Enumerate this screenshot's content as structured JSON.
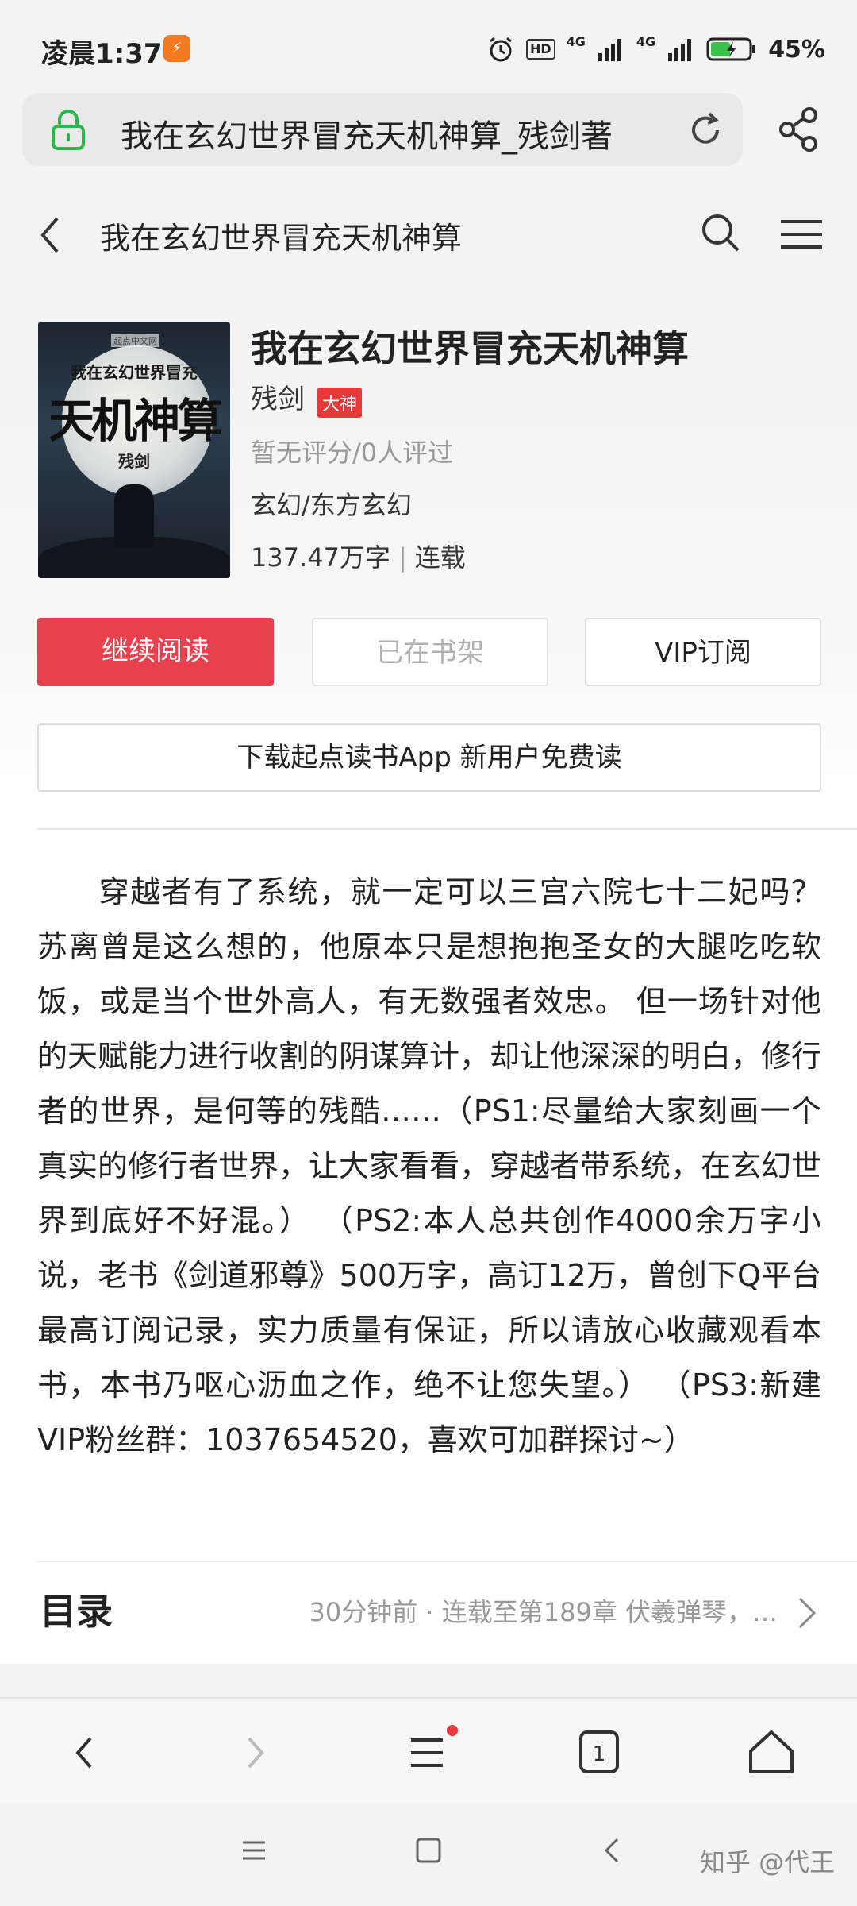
{
  "status_bar": {
    "time": "凌晨1:37",
    "app_icon_label": "",
    "hd": "HD",
    "net1": "4G",
    "net2": "4G",
    "battery": "45%"
  },
  "url_bar": {
    "url_text": "我在玄幻世界冒充天机神算_残剑著",
    "icons": [
      "lock-icon",
      "reload-icon",
      "share-icon"
    ]
  },
  "header": {
    "title": "我在玄幻世界冒充天机神算",
    "icons": [
      "back-icon",
      "search-icon",
      "menu-icon"
    ]
  },
  "book": {
    "cover": {
      "logo": "起点中文网",
      "subtitle": "我在玄幻世界冒充",
      "title": "天机神算",
      "author": "残剑"
    },
    "title": "我在玄幻世界冒充天机神算",
    "author": "残剑",
    "author_badge": "大神",
    "rating": "暂无评分/0人评过",
    "category": "玄幻/东方玄幻",
    "word_count": "137.47万字",
    "separator": "|",
    "status": "连载"
  },
  "actions": {
    "continue_label": "继续阅读",
    "shelf_label": "已在书架",
    "vip_label": "VIP订阅",
    "download_label": "下载起点读书App 新用户免费读"
  },
  "description": "穿越者有了系统，就一定可以三宫六院七十二妃吗？ 苏离曾是这么想的，他原本只是想抱抱圣女的大腿吃吃软饭，或是当个世外高人，有无数强者效忠。 但一场针对他的天赋能力进行收割的阴谋算计，却让他深深的明白，修行者的世界，是何等的残酷……（PS1:尽量给大家刻画一个真实的修行者世界，让大家看看，穿越者带系统，在玄幻世界到底好不好混。） （PS2:本人总共创作4000余万字小说，老书《剑道邪尊》500万字，高订12万，曾创下Q平台最高订阅记录，实力质量有保证，所以请放心收藏观看本书，本书乃呕心沥血之作，绝不让您失望。） （PS3:新建VIP粉丝群：1037654520，喜欢可加群探讨~）",
  "catalog": {
    "title": "目录",
    "info": "30分钟前 · 连载至第189章 伏羲弹琴，…"
  },
  "toolbar": {
    "buttons": [
      "back-arrow-icon",
      "forward-arrow-icon",
      "menu-lines-icon",
      "tabs-icon",
      "home-icon"
    ],
    "tabs_count": "1",
    "menu_has_dot": true
  },
  "system_nav": {
    "buttons": [
      "recents-icon",
      "home-square-icon",
      "back-triangle-icon"
    ],
    "watermark": "知乎 @代王"
  },
  "colors": {
    "accent_red": "#e8414d",
    "badge_red": "#e8393a",
    "lock_green": "#2db84d"
  }
}
